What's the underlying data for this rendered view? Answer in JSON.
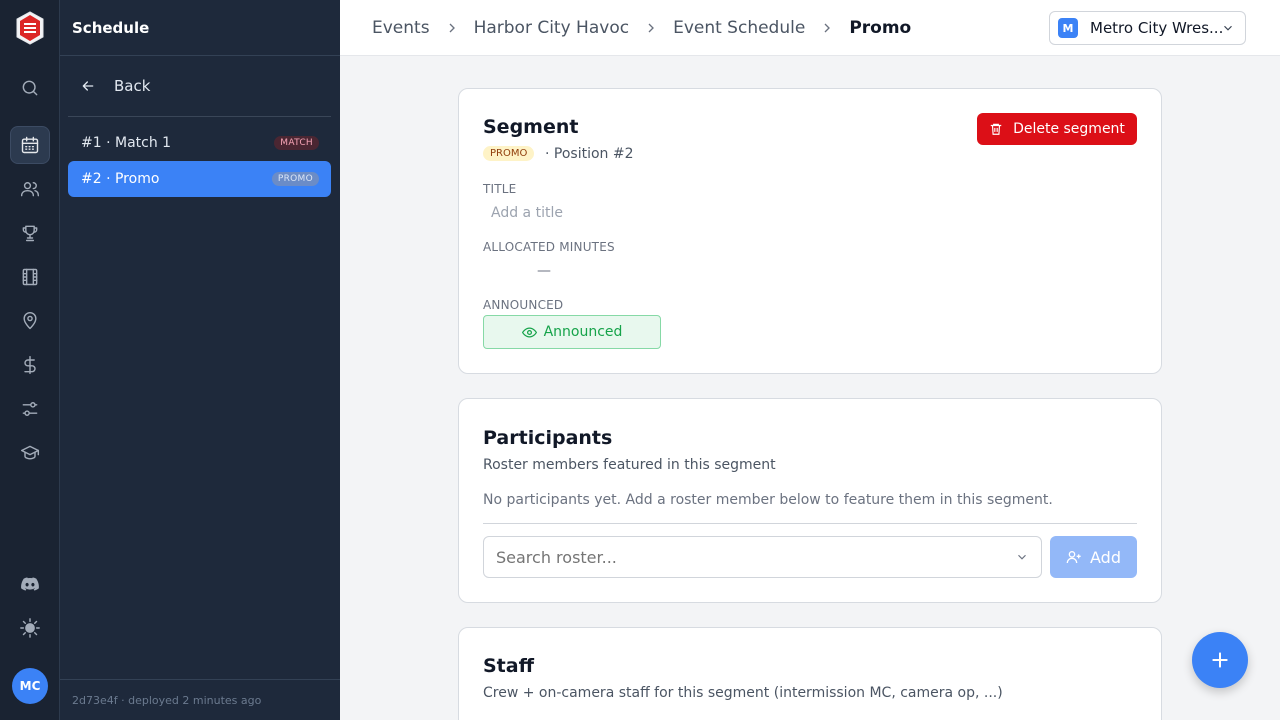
{
  "rail": {
    "items": [
      {
        "icon": "search-icon"
      },
      {
        "icon": "calendar-icon",
        "active": true
      },
      {
        "icon": "users-icon"
      },
      {
        "icon": "trophy-icon"
      },
      {
        "icon": "film-icon"
      },
      {
        "icon": "map-pin-icon"
      },
      {
        "icon": "dollar-icon"
      },
      {
        "icon": "sliders-icon"
      },
      {
        "icon": "graduation-cap-icon"
      }
    ],
    "bottom": [
      {
        "icon": "discord-icon"
      },
      {
        "icon": "sun-icon"
      }
    ],
    "avatar_initials": "MC"
  },
  "sidebar": {
    "title": "Schedule",
    "back_label": "Back",
    "items": [
      {
        "label": "#1 · Match 1",
        "badge": "MATCH"
      },
      {
        "label": "#2 · Promo",
        "badge": "PROMO",
        "active": true
      }
    ],
    "footer": {
      "hash": "2d73e4f",
      "deployed": "· deployed 2 minutes ago"
    }
  },
  "breadcrumb": [
    "Events",
    "Harbor City Havoc",
    "Event Schedule",
    "Promo"
  ],
  "org": {
    "initial": "M",
    "name": "Metro City Wres..."
  },
  "segment": {
    "heading": "Segment",
    "type_badge": "PROMO",
    "position": "· Position #2",
    "delete_label": "Delete segment",
    "title_label": "TITLE",
    "title_placeholder": "Add a title",
    "minutes_label": "ALLOCATED MINUTES",
    "minutes_value": "—",
    "announced_label": "ANNOUNCED",
    "announced_button": "Announced"
  },
  "participants": {
    "heading": "Participants",
    "subtitle": "Roster members featured in this segment",
    "empty_text": "No participants yet. Add a roster member below to feature them in this segment.",
    "search_placeholder": "Search roster...",
    "add_label": "Add"
  },
  "staff": {
    "heading": "Staff",
    "subtitle": "Crew + on-camera staff for this segment (intermission MC, camera op, ...)"
  },
  "colors": {
    "accent": "#3b82f6",
    "danger": "#dc0f17",
    "success": "#16a34a",
    "sidebar_bg": "#1e293b",
    "rail_bg": "#1a2332"
  }
}
